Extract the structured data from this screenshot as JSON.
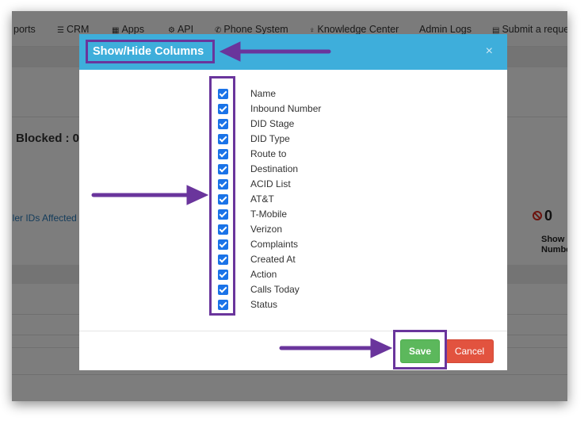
{
  "nav": {
    "items": [
      {
        "label": "ports",
        "icon": ""
      },
      {
        "label": "CRM",
        "icon": "list-icon"
      },
      {
        "label": "Apps",
        "icon": "grid-icon"
      },
      {
        "label": "API",
        "icon": "gear-icon"
      },
      {
        "label": "Phone System",
        "icon": "phone-icon"
      },
      {
        "label": "Knowledge Center",
        "icon": "lightbulb-icon"
      },
      {
        "label": "Admin Logs",
        "icon": ""
      },
      {
        "label": "Submit a reque",
        "icon": "ticket-icon"
      }
    ]
  },
  "background": {
    "blocked_label": "Blocked : 0",
    "affected_link": "ller IDs Affected",
    "right_count": "0",
    "right_label_line1": "Show",
    "right_label_line2": "Numbe"
  },
  "modal": {
    "title": "Show/Hide Columns",
    "close_glyph": "×",
    "columns": [
      {
        "label": "Name",
        "checked": true
      },
      {
        "label": "Inbound Number",
        "checked": true
      },
      {
        "label": "DID Stage",
        "checked": true
      },
      {
        "label": "DID Type",
        "checked": true
      },
      {
        "label": "Route to",
        "checked": true
      },
      {
        "label": "Destination",
        "checked": true
      },
      {
        "label": "ACID List",
        "checked": true
      },
      {
        "label": "AT&T",
        "checked": true
      },
      {
        "label": "T-Mobile",
        "checked": true
      },
      {
        "label": "Verizon",
        "checked": true
      },
      {
        "label": "Complaints",
        "checked": true
      },
      {
        "label": "Created At",
        "checked": true
      },
      {
        "label": "Action",
        "checked": true
      },
      {
        "label": "Calls Today",
        "checked": true
      },
      {
        "label": "Status",
        "checked": true
      }
    ],
    "save_label": "Save",
    "cancel_label": "Cancel"
  },
  "colors": {
    "header": "#3eaedb",
    "save": "#5cb85c",
    "cancel": "#e2533f",
    "annotation": "#6a359c",
    "checkbox": "#1a73e8"
  }
}
